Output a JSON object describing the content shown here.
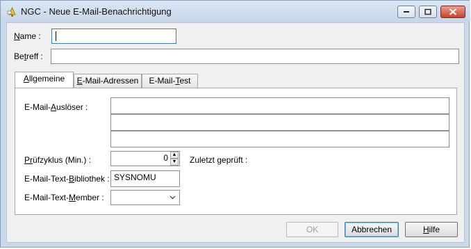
{
  "window": {
    "title": "NGC - Neue E-Mail-Benachrichtigung",
    "minimize_icon": "minimize-icon",
    "maximize_icon": "maximize-icon",
    "close_icon": "close-icon"
  },
  "form": {
    "name_label_u": "N",
    "name_label_rest": "ame :",
    "name_value": "",
    "betreff_label_pre": "Be",
    "betreff_label_u": "t",
    "betreff_label_rest": "reff :",
    "betreff_value": ""
  },
  "tabs": [
    {
      "pre": "",
      "u": "A",
      "rest": "llgemeine"
    },
    {
      "pre": "",
      "u": "E",
      "rest": "-Mail-Adressen"
    },
    {
      "pre": "E-Mail-",
      "u": "T",
      "rest": "est"
    }
  ],
  "general": {
    "trigger_label_pre": "E-Mail-",
    "trigger_label_u": "A",
    "trigger_label_rest": "uslöser :",
    "trigger_values": [
      "",
      "",
      ""
    ],
    "cycle_label_pre": "P",
    "cycle_label_u": "r",
    "cycle_label_rest": "üfzyklus (Min.) :",
    "cycle_value": "0",
    "last_checked_label": "Zuletzt geprüft :",
    "library_label_pre": "E-Mail-Text-",
    "library_label_u": "B",
    "library_label_rest": "ibliothek :",
    "library_value": "SYSNOMU",
    "member_label_pre": "E-Mail-Text-",
    "member_label_u": "M",
    "member_label_rest": "ember :",
    "member_value": ""
  },
  "buttons": {
    "ok": "OK",
    "cancel": "Abbrechen",
    "help_u": "H",
    "help_rest": "ilfe"
  }
}
